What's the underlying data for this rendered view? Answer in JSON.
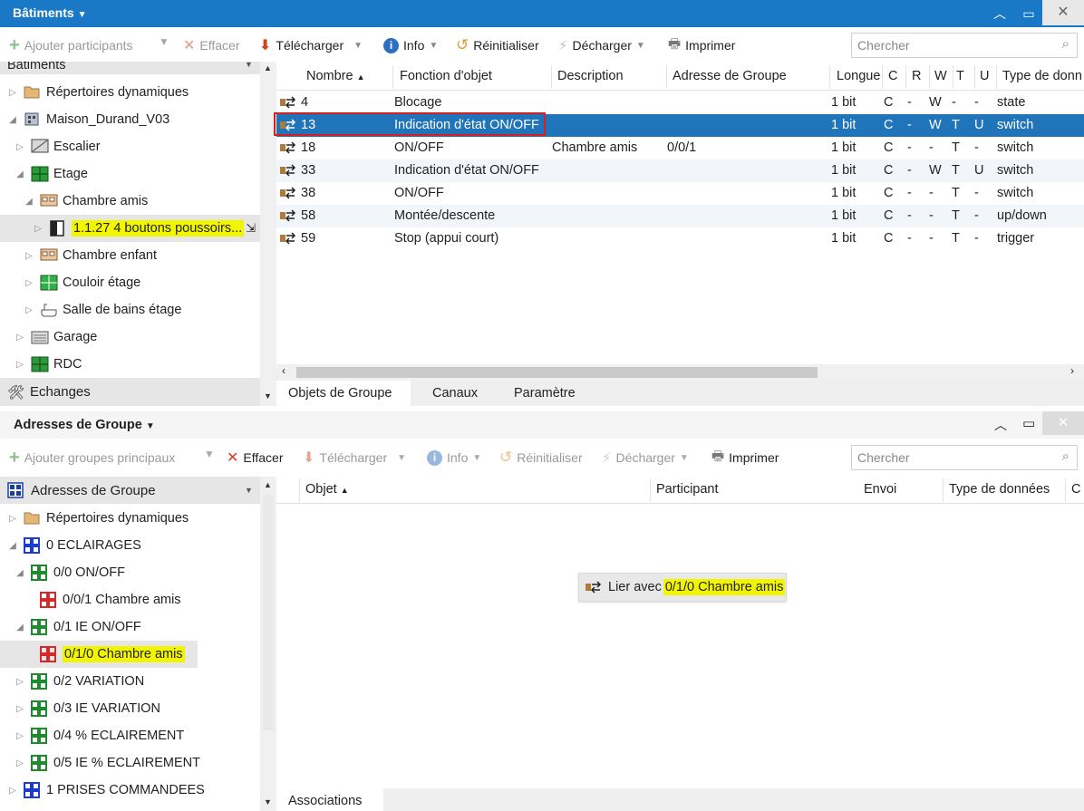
{
  "top_window": {
    "title": "Bâtiments",
    "toolbar": {
      "add_participants": "Ajouter participants",
      "delete": "Effacer",
      "upload": "Télécharger",
      "info": "Info",
      "reset": "Réinitialiser",
      "unload": "Décharger",
      "print": "Imprimer",
      "search_placeholder": "Chercher"
    },
    "tree": {
      "header": "Bâtiments",
      "items": [
        {
          "label": "Répertoires dynamiques"
        },
        {
          "label": "Maison_Durand_V03"
        },
        {
          "label": "Escalier"
        },
        {
          "label": "Etage"
        },
        {
          "label": "Chambre amis"
        },
        {
          "label": "1.1.27 4 boutons poussoirs..."
        },
        {
          "label": "Chambre enfant"
        },
        {
          "label": "Couloir étage"
        },
        {
          "label": "Salle de bains étage"
        },
        {
          "label": "Garage"
        },
        {
          "label": "RDC"
        }
      ],
      "footer": "Echanges"
    },
    "grid": {
      "columns": [
        "Nombre",
        "Fonction d'objet",
        "Description",
        "Adresse de Groupe",
        "Longue",
        "C",
        "R",
        "W",
        "T",
        "U",
        "Type de donn"
      ],
      "rows": [
        {
          "num": "4",
          "func": "Blocage",
          "desc": "",
          "addr": "",
          "len": "1 bit",
          "c": "C",
          "r": "-",
          "w": "W",
          "t": "-",
          "u": "-",
          "type": "state"
        },
        {
          "num": "13",
          "func": "Indication d'état ON/OFF",
          "desc": "",
          "addr": "",
          "len": "1 bit",
          "c": "C",
          "r": "-",
          "w": "W",
          "t": "T",
          "u": "U",
          "type": "switch"
        },
        {
          "num": "18",
          "func": "ON/OFF",
          "desc": "Chambre amis",
          "addr": "0/0/1",
          "len": "1 bit",
          "c": "C",
          "r": "-",
          "w": "-",
          "t": "T",
          "u": "-",
          "type": "switch"
        },
        {
          "num": "33",
          "func": "Indication d'état ON/OFF",
          "desc": "",
          "addr": "",
          "len": "1 bit",
          "c": "C",
          "r": "-",
          "w": "W",
          "t": "T",
          "u": "U",
          "type": "switch"
        },
        {
          "num": "38",
          "func": "ON/OFF",
          "desc": "",
          "addr": "",
          "len": "1 bit",
          "c": "C",
          "r": "-",
          "w": "-",
          "t": "T",
          "u": "-",
          "type": "switch"
        },
        {
          "num": "58",
          "func": "Montée/descente",
          "desc": "",
          "addr": "",
          "len": "1 bit",
          "c": "C",
          "r": "-",
          "w": "-",
          "t": "T",
          "u": "-",
          "type": "up/down"
        },
        {
          "num": "59",
          "func": "Stop (appui court)",
          "desc": "",
          "addr": "",
          "len": "1 bit",
          "c": "C",
          "r": "-",
          "w": "-",
          "t": "T",
          "u": "-",
          "type": "trigger"
        }
      ]
    },
    "tabs": [
      "Objets de Groupe",
      "Canaux",
      "Paramètre"
    ]
  },
  "bottom_window": {
    "title": "Adresses de Groupe",
    "toolbar": {
      "add_main_groups": "Ajouter groupes principaux",
      "delete": "Effacer",
      "upload": "Télécharger",
      "info": "Info",
      "reset": "Réinitialiser",
      "unload": "Décharger",
      "print": "Imprimer",
      "search_placeholder": "Chercher"
    },
    "tree": {
      "header": "Adresses de Groupe",
      "items": [
        {
          "label": "Répertoires dynamiques"
        },
        {
          "label": "0 ECLAIRAGES"
        },
        {
          "label": "0/0 ON/OFF"
        },
        {
          "label": "0/0/1 Chambre amis"
        },
        {
          "label": "0/1 IE ON/OFF"
        },
        {
          "label": "0/1/0 Chambre amis"
        },
        {
          "label": "0/2 VARIATION"
        },
        {
          "label": "0/3 IE VARIATION"
        },
        {
          "label": "0/4 % ECLAIREMENT"
        },
        {
          "label": "0/5 IE % ECLAIREMENT"
        },
        {
          "label": "1 PRISES COMMANDEES"
        }
      ]
    },
    "grid": {
      "columns": [
        "Objet",
        "Participant",
        "Envoi",
        "Type de données",
        "C"
      ]
    },
    "drag_tooltip": {
      "prefix": "Lier avec",
      "target": "0/1/0 Chambre amis"
    },
    "tabs": [
      "Associations"
    ]
  },
  "colors": {
    "titlebar": "#1a79c7",
    "selection": "#1f74ba",
    "highlight": "#f2f500",
    "red_outline": "#d42020"
  }
}
